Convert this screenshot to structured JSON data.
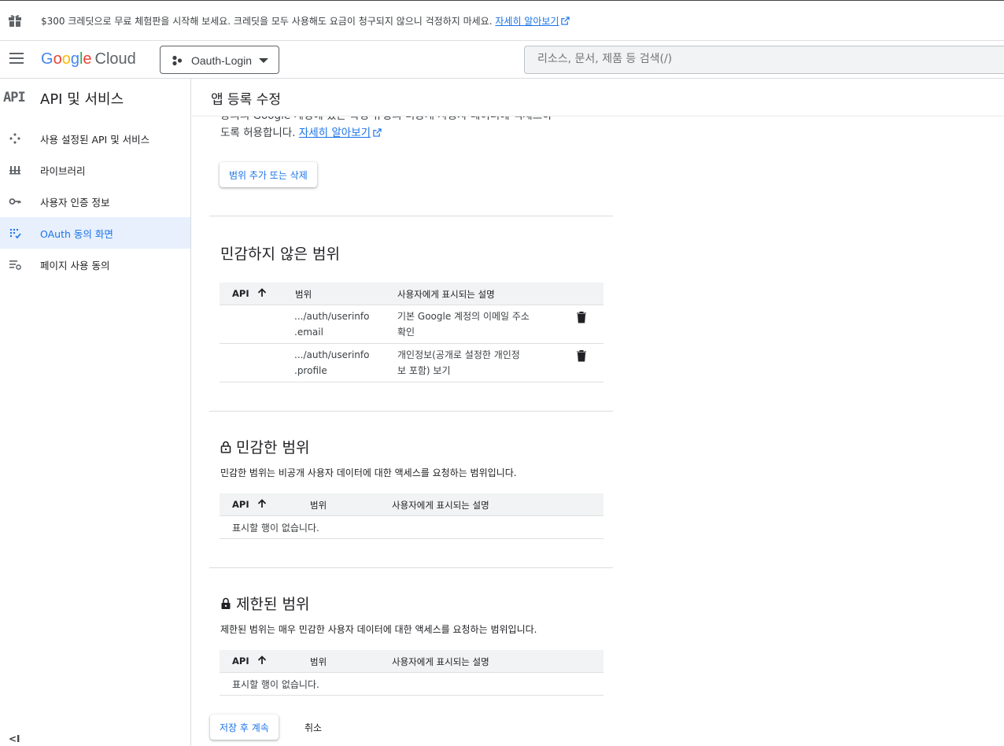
{
  "banner": {
    "message": "$300 크레딧으로 무료 체험판을 시작해 보세요. 크레딧을 모두 사용해도 요금이 청구되지 않으니 걱정하지 마세요.",
    "link": "자세히 알아보기"
  },
  "header": {
    "logo_google": "Google",
    "logo_cloud": "Cloud",
    "project_name": "Oauth-Login",
    "search_placeholder": "리소스, 문서, 제품 등 검색(/)"
  },
  "sidebar": {
    "icon_text": "API",
    "title": "API 및 서비스",
    "items": [
      {
        "label": "사용 설정된 API 및 서비스",
        "icon": "enabled-apis-icon"
      },
      {
        "label": "라이브러리",
        "icon": "library-icon"
      },
      {
        "label": "사용자 인증 정보",
        "icon": "key-icon"
      },
      {
        "label": "OAuth 동의 화면",
        "icon": "oauth-consent-icon",
        "active": true
      },
      {
        "label": "페이지 사용 동의",
        "icon": "page-usage-agreement-icon"
      }
    ],
    "collapse_label": "<I"
  },
  "main": {
    "title": "앱 등록 수정",
    "partial_text": "동의의 Google 계정에 있는 특정 유형의 비공개 사용자 데이터에 액세스하",
    "partial_text2": "도록 허용합니다.",
    "partial_link": "자세히 알아보기",
    "add_scope_button": "범위 추가 또는 삭제",
    "non_sensitive": {
      "title": "민감하지 않은 범위",
      "columns": [
        "API",
        "범위",
        "사용자에게 표시되는 설명"
      ],
      "rows": [
        {
          "scope_line1": ".../auth/userinfo",
          "scope_line2": ".email",
          "desc_line1": "기본 Google 계정의 이메일 주소",
          "desc_line2": "확인"
        },
        {
          "scope_line1": ".../auth/userinfo",
          "scope_line2": ".profile",
          "desc_line1": "개인정보(공개로 설정한 개인정",
          "desc_line2": "보 포함) 보기"
        }
      ]
    },
    "sensitive": {
      "title": "민감한 범위",
      "desc": "민감한 범위는 비공개 사용자 데이터에 대한 액세스를 요청하는 범위입니다.",
      "columns": [
        "API",
        "범위",
        "사용자에게 표시되는 설명"
      ],
      "empty": "표시할 행이 없습니다."
    },
    "restricted": {
      "title": "제한된 범위",
      "desc": "제한된 범위는 매우 민감한 사용자 데이터에 대한 액세스를 요청하는 범위입니다.",
      "columns": [
        "API",
        "범위",
        "사용자에게 표시되는 설명"
      ],
      "empty": "표시할 행이 없습니다."
    },
    "save_button": "저장 후 계속",
    "cancel_button": "취소"
  },
  "colors": {
    "accent": "#1a73e8",
    "active_bg": "#e8f0fe",
    "google_blue": "#4285f4",
    "google_red": "#ea4335",
    "google_yellow": "#fbbc05",
    "google_green": "#34a853"
  }
}
